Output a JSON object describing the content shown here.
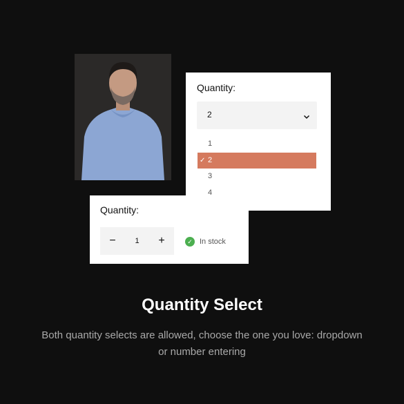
{
  "dropdown_card": {
    "label": "Quantity:",
    "selected": "2",
    "options": [
      "1",
      "2",
      "3",
      "4"
    ],
    "selected_index": 1,
    "check_glyph": "✓",
    "highlight_color": "#d57a5e"
  },
  "stepper_card": {
    "label": "Quantity:",
    "minus": "−",
    "value": "1",
    "plus": "+",
    "stock_icon": "check-circle-icon",
    "stock_text": "In stock",
    "stock_color": "#4caf50"
  },
  "feature": {
    "title": "Quantity Select",
    "description": "Both quantity selects are allowed, choose the one you love: dropdown or number entering"
  },
  "photo": {
    "subject": "product-model-photo"
  }
}
